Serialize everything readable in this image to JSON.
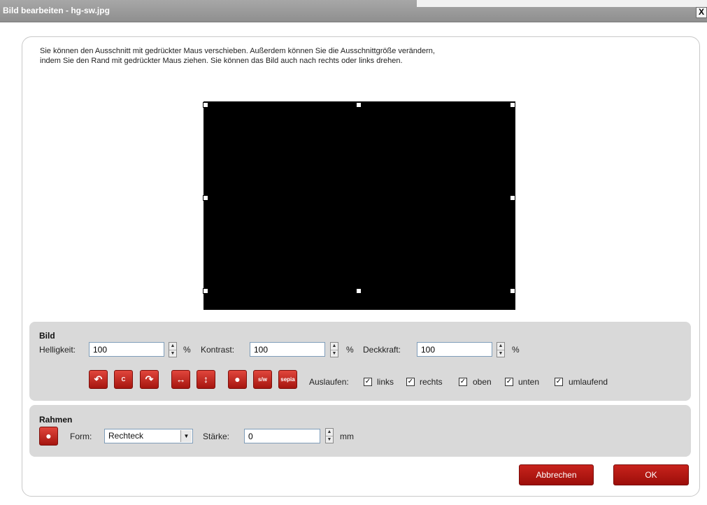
{
  "window": {
    "title": "Bild bearbeiten - hg-sw.jpg",
    "close_label": "X"
  },
  "instructions": {
    "line1": "Sie können den Ausschnitt mit gedrückter Maus verschieben. Außerdem können Sie die Ausschnittgröße verändern,",
    "line2": "indem Sie den Rand mit gedrückter Maus ziehen. Sie können das Bild auch nach rechts oder links drehen."
  },
  "bild": {
    "title": "Bild",
    "brightness_label": "Helligkeit:",
    "brightness_value": "100",
    "contrast_label": "Kontrast:",
    "contrast_value": "100",
    "opacity_label": "Deckkraft:",
    "opacity_value": "100",
    "percent": "%",
    "buttons": {
      "rotate_left": "↶",
      "crop": "C",
      "rotate_right": "↷",
      "flip_horizontal": "↔",
      "flip_vertical": "↕",
      "color": "●",
      "bw": "s/w",
      "sepia": "sepia"
    },
    "bleed_label": "Auslaufen:",
    "bleed": [
      {
        "label": "links",
        "checked": true
      },
      {
        "label": "rechts",
        "checked": true
      },
      {
        "label": "oben",
        "checked": true
      },
      {
        "label": "unten",
        "checked": true
      },
      {
        "label": "umlaufend",
        "checked": true
      }
    ],
    "check_mark": "✓"
  },
  "rahmen": {
    "title": "Rahmen",
    "form_label": "Form:",
    "form_value": "Rechteck",
    "thickness_label": "Stärke:",
    "thickness_value": "0",
    "unit": "mm"
  },
  "actions": {
    "cancel": "Abbrechen",
    "ok": "OK"
  },
  "colors": {
    "accent_red": "#b8160f",
    "panel": "#d9d9d9",
    "titlebar": "#9a9a9a"
  }
}
